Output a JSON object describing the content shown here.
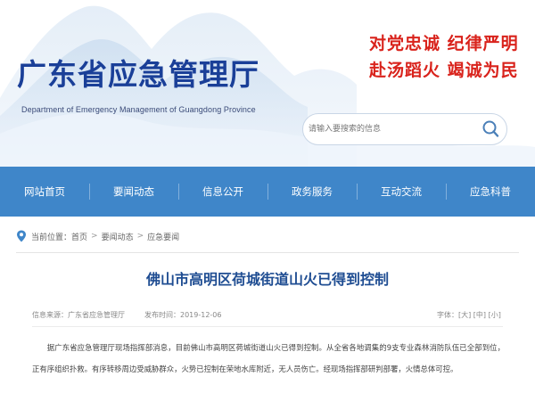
{
  "header": {
    "title": "广东省应急管理厅",
    "subtitle": "Department of Emergency Management of Guangdong Province",
    "slogan_line1": "对党忠诚  纪律严明",
    "slogan_line2": "赴汤蹈火  竭诚为民",
    "brand_color": "#1a3f98",
    "slogan_color": "#d9231c"
  },
  "search": {
    "placeholder": "请输入要搜索的信息",
    "button_icon": "search-icon"
  },
  "nav": {
    "background": "#3f86c9",
    "items": [
      "网站首页",
      "要闻动态",
      "信息公开",
      "政务服务",
      "互动交流",
      "应急科普"
    ]
  },
  "breadcrumb": {
    "icon": "location-pin-icon",
    "prefix": "当前位置：",
    "items": [
      "首页",
      "要闻动态",
      "应急要闻"
    ],
    "separator": ">"
  },
  "article": {
    "title": "佛山市高明区荷城街道山火已得到控制",
    "source_label": "信息来源：广东省应急管理厅",
    "date": "发布时间：2019-12-06",
    "font_size_label": "字体：",
    "font_sizes": [
      "大",
      "中",
      "小"
    ],
    "body": "据广东省应急管理厅现场指挥部消息，目前佛山市高明区荷城街道山火已得到控制。从全省各地调集的9支专业森林消防队伍已全部到位，正有序组织扑救。有序转移周边受威胁群众，火势已控制在荣地水库附近，无人员伤亡。经现场指挥部研判部署，火情总体可控。"
  }
}
